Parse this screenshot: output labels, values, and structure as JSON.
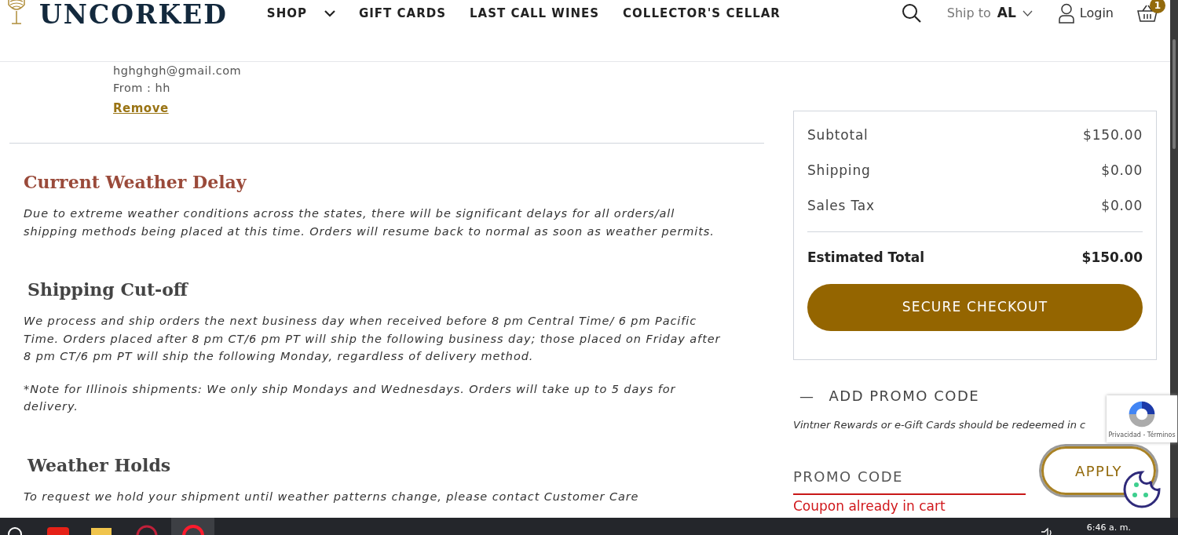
{
  "header": {
    "logo": "UNCORKED",
    "nav": [
      {
        "label": "SHOP",
        "dropdown": true
      },
      {
        "label": "GIFT CARDS",
        "dropdown": false
      },
      {
        "label": "LAST CALL WINES",
        "dropdown": false
      },
      {
        "label": "COLLECTOR'S CELLAR",
        "dropdown": false
      }
    ],
    "ship_to_label": "Ship to",
    "ship_to_state": "AL",
    "login": "Login",
    "cart_count": "1"
  },
  "gift_card": {
    "email": "hghghgh@gmail.com",
    "from": "From : hh",
    "remove": "Remove"
  },
  "notices": [
    {
      "title": "Current Weather Delay",
      "paragraphs": [
        "Due to extreme weather conditions across the states, there will be significant delays for all orders/all shipping methods being placed at this time. Orders will resume back to normal as soon as weather permits."
      ]
    },
    {
      "title": "Shipping Cut-off",
      "paragraphs": [
        "We process and ship orders the next business day when received before 8 pm Central Time/ 6 pm Pacific Time. Orders placed after 8 pm CT/6 pm PT will ship the following business day; those placed on Friday after 8 pm CT/6 pm PT will ship the following Monday, regardless of delivery method.",
        "*Note for Illinois shipments: We only ship Mondays and Wednesdays. Orders will take up to 5 days for delivery."
      ]
    },
    {
      "title": "Weather Holds",
      "paragraphs": [
        "To request we hold your shipment until weather patterns change, please contact Customer Care"
      ]
    }
  ],
  "summary": {
    "lines": [
      {
        "label": "Subtotal",
        "value": "$150.00"
      },
      {
        "label": "Shipping",
        "value": "$0.00"
      },
      {
        "label": "Sales Tax",
        "value": "$0.00"
      }
    ],
    "total_label": "Estimated Total",
    "total_value": "$150.00",
    "checkout": "SECURE CHECKOUT"
  },
  "promo": {
    "toggle": "—",
    "title": "ADD PROMO CODE",
    "expanded": true,
    "note": "Vintner Rewards or e-Gift Cards should be redeemed in c",
    "placeholder": "PROMO CODE",
    "apply": "APPLY",
    "error": "Coupon already in cart"
  },
  "recaptcha": {
    "links": "Privacidad - Términos"
  },
  "taskbar": {
    "time": "6:46 a. m."
  }
}
